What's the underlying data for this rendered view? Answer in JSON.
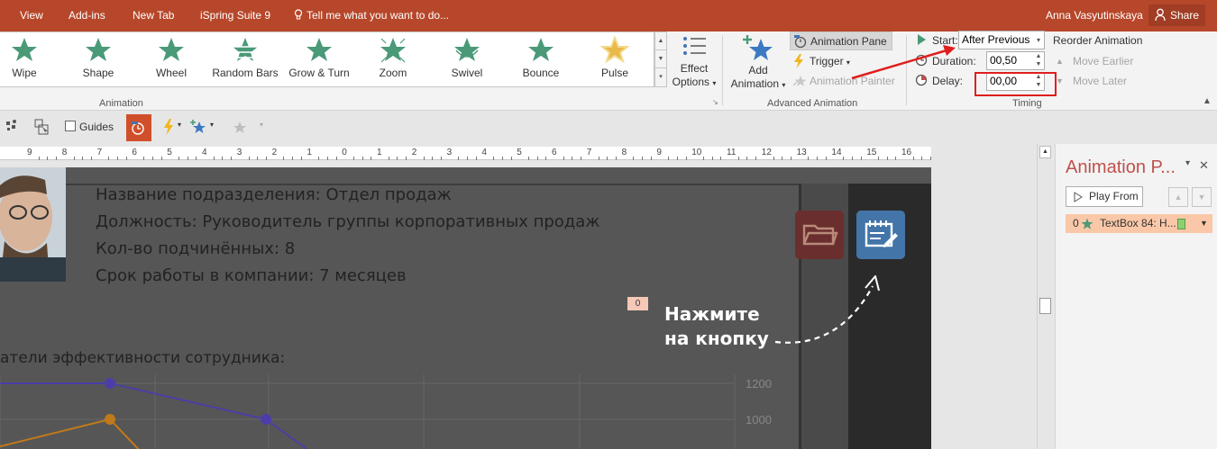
{
  "tabs": [
    {
      "label": "View"
    },
    {
      "label": "Add-ins"
    },
    {
      "label": "New Tab"
    },
    {
      "label": "iSpring Suite 9"
    }
  ],
  "tell_me": "Tell me what you want to do...",
  "user_name": "Anna Vasyutinskaya",
  "share_label": "Share",
  "animations": [
    {
      "label": "Wipe",
      "icon": "wipe-star-icon"
    },
    {
      "label": "Shape",
      "icon": "shape-star-icon"
    },
    {
      "label": "Wheel",
      "icon": "wheel-star-icon"
    },
    {
      "label": "Random Bars",
      "icon": "random-bars-star-icon"
    },
    {
      "label": "Grow & Turn",
      "icon": "grow-turn-star-icon"
    },
    {
      "label": "Zoom",
      "icon": "zoom-star-icon"
    },
    {
      "label": "Swivel",
      "icon": "swivel-star-icon"
    },
    {
      "label": "Bounce",
      "icon": "bounce-star-icon"
    },
    {
      "label": "Pulse",
      "icon": "pulse-star-icon"
    }
  ],
  "groups": {
    "animation": "Animation",
    "advanced": "Advanced Animation",
    "timing": "Timing"
  },
  "effect_options": {
    "line1": "Effect",
    "line2": "Options"
  },
  "add_animation": {
    "line1": "Add",
    "line2": "Animation"
  },
  "advanced": {
    "animation_pane": "Animation Pane",
    "trigger": "Trigger",
    "animation_painter": "Animation Painter"
  },
  "timing": {
    "start_label": "Start:",
    "start_value": "After Previous",
    "duration_label": "Duration:",
    "duration_value": "00,50",
    "delay_label": "Delay:",
    "delay_value": "00,00",
    "reorder_title": "Reorder Animation",
    "move_earlier": "Move Earlier",
    "move_later": "Move Later"
  },
  "toolbar2": {
    "guides": "Guides"
  },
  "ruler_numbers": [
    "9",
    "8",
    "7",
    "6",
    "5",
    "4",
    "3",
    "2",
    "1",
    "0",
    "1",
    "2",
    "3",
    "4",
    "5",
    "6",
    "7",
    "8",
    "9",
    "10",
    "11",
    "12",
    "13",
    "14",
    "15",
    "16"
  ],
  "slide": {
    "info_lines": [
      "Название подразделения: Отдел продаж",
      "Должность: Руководитель группы корпоративных продаж",
      "Кол-во подчинённых: 8",
      "Срок работы в компании: 7 месяцев"
    ],
    "tag": "0",
    "press_line1": "Нажмите",
    "press_line2": "на кнопку",
    "kpi_title": "атели эффективности сотрудника:"
  },
  "chart_data": {
    "type": "line",
    "y_tick_labels": [
      "1200",
      "1000"
    ],
    "series": [
      {
        "color": "#4b3ea8",
        "values": [
          1200,
          1200,
          1000,
          800
        ]
      },
      {
        "color": "#c07a1a",
        "values": [
          800,
          1000,
          800
        ]
      }
    ]
  },
  "pane": {
    "title": "Animation P...",
    "play_from": "Play From",
    "item_label": "TextBox 84: H...",
    "item_number": "0"
  },
  "colors": {
    "accent": "#b7472a",
    "star_green": "#4a9a78",
    "pane_title": "#c0504d",
    "annotation_red": "#e01e1e"
  }
}
